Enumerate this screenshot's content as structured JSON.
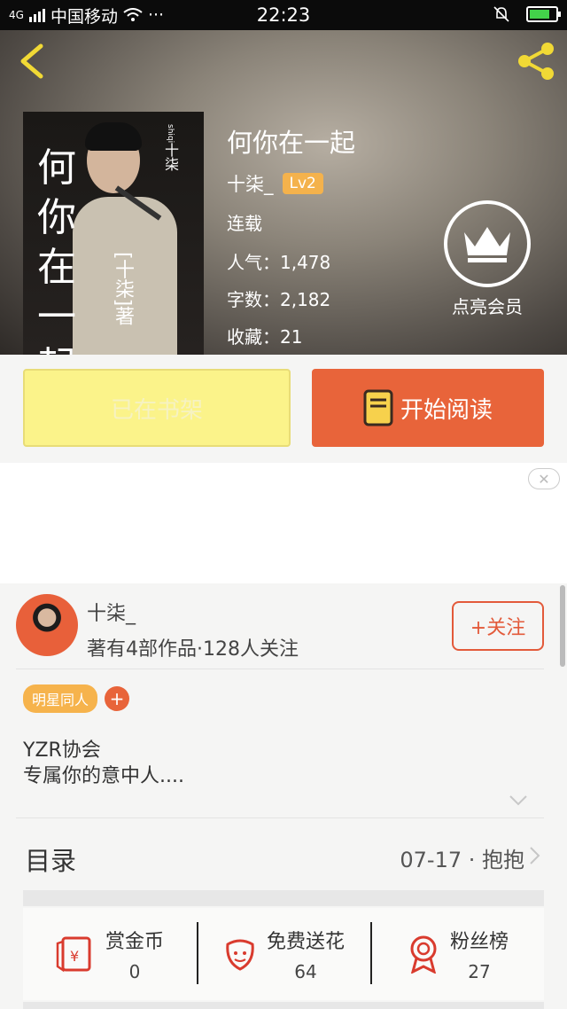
{
  "status_bar": {
    "signal": "4G",
    "carrier": "中国移动",
    "more": "···",
    "time": "22:23",
    "battery_level": 0.8
  },
  "book": {
    "title": "何你在一起",
    "author": "十柒_",
    "level": "Lv2",
    "status": "连载",
    "popularity": "人气：1,478",
    "word_count": "字数：2,182",
    "favorites": "收藏：21",
    "cover": {
      "title": "何你在一起",
      "pinyin": "shiqi",
      "signature": "十柒",
      "author_mark": "[十柒]著"
    }
  },
  "vip": {
    "label": "点亮会员"
  },
  "actions": {
    "shelf_label": "已在书架",
    "read_label": "开始阅读"
  },
  "ad": {
    "close": "✕"
  },
  "author_card": {
    "name": "十柒_",
    "meta": "著有4部作品·128人关注",
    "follow": "+关注"
  },
  "tags": {
    "items": [
      "明星同人"
    ],
    "add": "+"
  },
  "description": {
    "line1": "YZR协会",
    "line2": "专属你的意中人...."
  },
  "toc": {
    "title": "目录",
    "latest": "07-17 · 抱抱"
  },
  "stats": [
    {
      "label": "赏金币",
      "value": "0",
      "icon": "red-envelope-icon"
    },
    {
      "label": "免费送花",
      "value": "64",
      "icon": "flower-icon"
    },
    {
      "label": "粉丝榜",
      "value": "27",
      "icon": "medal-icon"
    }
  ],
  "colors": {
    "accent": "#e8643a",
    "shelf_button": "#fbf38a",
    "badge": "#f4b24c"
  }
}
